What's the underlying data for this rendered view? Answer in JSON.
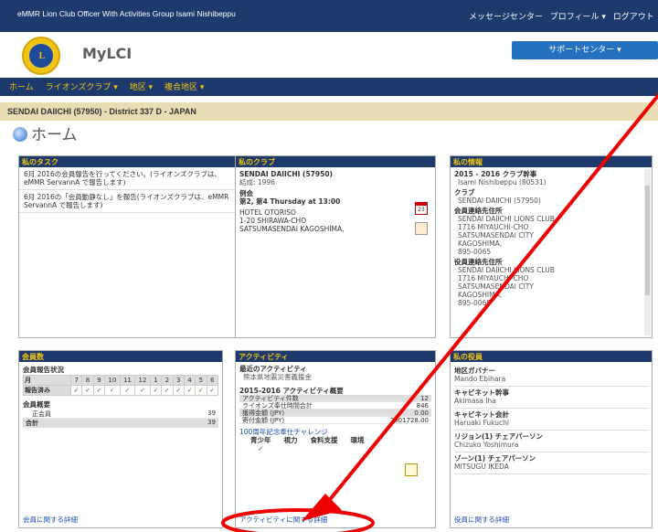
{
  "top": {
    "user": "eMMR Lion Club Officer With Activities Group Isami Nishibeppu",
    "links": [
      "メッセージセンター",
      "プロフィール ▾",
      "ログアウト"
    ]
  },
  "brand": {
    "title": "MyLCI",
    "logo_text": "L",
    "support": "サポートセンター ▾"
  },
  "nav": [
    "ホーム",
    "ライオンズクラブ ▾",
    "地区 ▾",
    "複合地区 ▾"
  ],
  "breadcrumb": "SENDAI DAIICHI (57950) - District 337 D - JAPAN",
  "page_title": "ホーム",
  "tasks": {
    "title": "私のタスク",
    "items": [
      "6月 2016の会員報告を行ってください。(ライオンズクラブは、eMMR ServannA で報告します)",
      "6月 2016の「会員動静なし」を報告(ライオンズクラブは、eMMR ServannA で報告します)"
    ]
  },
  "club": {
    "title": "私のクラブ",
    "name": "SENDAI DAIICHI (57950)",
    "chartered": "結成: 1996",
    "meeting_label": "例会",
    "meeting": "第2, 第4 Thursday at 13:00",
    "addr": [
      "HOTEL OTORISO",
      "1-20 SHIRAWA-CHO",
      "SATSUMASENDAI KAGOSHIMA,"
    ],
    "cal": "23"
  },
  "info": {
    "title": "私の情報",
    "role": "2015 - 2016 クラブ幹事",
    "role_name": "Isami Nishibeppu (80531)",
    "club_label": "クラブ",
    "club_val": "SENDAI DAIICHI (57950)",
    "contact_label": "会員連絡先住所",
    "contact": [
      "SENDAI DAIICHI LIONS CLUB",
      "1716 MIYAUCHI-CHO",
      "SATSUMASENDAI CITY",
      "KAGOSHIMA,",
      "895-0065"
    ],
    "officer_label": "役員連絡先住所",
    "officer": [
      "SENDAI DAIICHI LIONS CLUB",
      "1716 MIYAUCHI-CHO",
      "SATSUMASENDAI CITY",
      "KAGOSHIMA,",
      "895-0065"
    ]
  },
  "members": {
    "title": "会員数",
    "report_label": "会員報告状況",
    "month_label": "月",
    "months": [
      "7",
      "8",
      "9",
      "10",
      "11",
      "12",
      "1",
      "2",
      "3",
      "4",
      "5",
      "6"
    ],
    "done_label": "報告済み",
    "checks": "✓",
    "summary_label": "会員概要",
    "rows": [
      {
        "k": "正会員",
        "v": "39"
      },
      {
        "k": "合計",
        "v": "39"
      }
    ],
    "footer": "会員に関する詳細"
  },
  "activities": {
    "title": "アクティビティ",
    "recent_label": "最近のアクティビティ",
    "recent": "熊本県地震災害義援金",
    "summary_title": "2015-2016 アクティビティ概要",
    "rows": [
      {
        "k": "アクティビティ件数",
        "v": "12"
      },
      {
        "k": "ライオンズ奉仕時間合計",
        "v": "846"
      },
      {
        "k": "獲得金額 (JPY)",
        "v": "0.00"
      },
      {
        "k": "寄付金額 (JPY)",
        "v": "2001728.00"
      }
    ],
    "challenge": "100周年記念奉仕チャレンジ",
    "cats": [
      "青少年",
      "視力",
      "食料支援",
      "環境"
    ],
    "challenge_check": "✓",
    "footer": "アクティビティに関する詳細"
  },
  "officers": {
    "title": "私の役員",
    "list": [
      {
        "k": "地区ガバナー",
        "v": "Mando Ebihara"
      },
      {
        "k": "キャビネット幹事",
        "v": "Akimasa Iha"
      },
      {
        "k": "キャビネット会計",
        "v": "Haruaki Fukuchi"
      },
      {
        "k": "リジョン(1) チェアパーソン",
        "v": "Chizuko Yoshimura"
      },
      {
        "k": "ゾーン(1) チェアパーソン",
        "v": "MITSUGU IKEDA"
      }
    ],
    "footer": "役員に関する詳細"
  },
  "colors": {
    "navy": "#1e3a6c",
    "gold": "#f1c40f",
    "arrow": "#e00000"
  }
}
